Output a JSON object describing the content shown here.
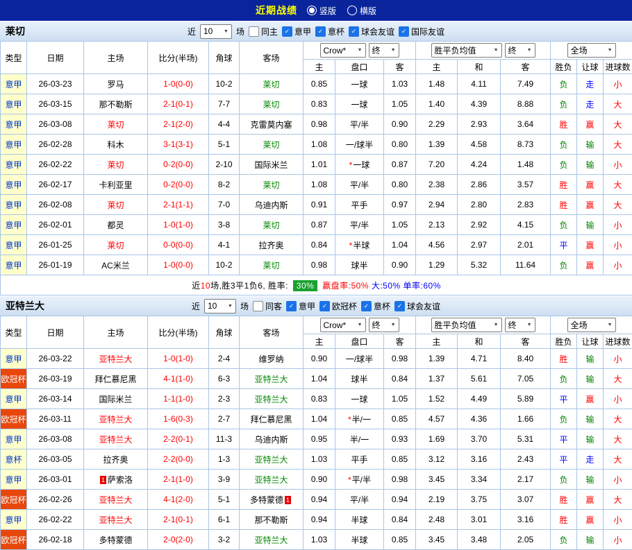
{
  "colors": {
    "topbar_bg": "#0a259c",
    "topbar_title": "#ffff00",
    "section_bar_bg": "#d2e2f4",
    "grid_border": "#a8c6e6",
    "league_serie_bg": "#ffffcc",
    "league_serie_text": "#0033cc",
    "league_ucl_bg": "#e8470b",
    "score_text": "#ff0000",
    "focal_home": "#ff0000",
    "focal_away": "#008800",
    "win_red": "#ff0000",
    "lose_green": "#008000",
    "draw_blue": "#0000ff",
    "checkbox_checked": "#1b73e8",
    "summary_badge_bg": "#18a12e"
  },
  "top_bar": {
    "title": "近期战绩",
    "layout_options": [
      {
        "label": "竖版",
        "selected": true
      },
      {
        "label": "横版",
        "selected": false
      }
    ]
  },
  "sections": [
    {
      "team": "莱切",
      "filter": {
        "near_label": "近",
        "count_value": "10",
        "unit_label": "场",
        "checkboxes": [
          {
            "label": "同主",
            "checked": false
          },
          {
            "label": "意甲",
            "checked": true
          },
          {
            "label": "意杯",
            "checked": true
          },
          {
            "label": "球会友谊",
            "checked": true
          },
          {
            "label": "国际友谊",
            "checked": true
          }
        ]
      },
      "header": {
        "cols": [
          "类型",
          "日期",
          "主场",
          "比分(半场)",
          "角球",
          "客场"
        ],
        "odds_company_select": "Crow*",
        "odds_time_select": "终",
        "europe_select": "胜平负均值",
        "europe_time_select": "终",
        "scope_select": "全场",
        "sub_cols": [
          "主",
          "盘口",
          "客",
          "主",
          "和",
          "客",
          "胜负",
          "让球",
          "进球数"
        ]
      },
      "rows": [
        {
          "league": "意甲",
          "lcls": "serie",
          "date": "26-03-23",
          "home": "罗马",
          "hcls": "",
          "hcard": "",
          "score": "1-0(0-0)",
          "corner": "10-2",
          "away": "莱切",
          "acls": "focal-away",
          "acard": "",
          "oh": "0.85",
          "line": "一球",
          "star": false,
          "oa": "1.03",
          "eu": [
            "1.48",
            "4.11",
            "7.49"
          ],
          "res": [
            {
              "t": "负",
              "c": "g"
            },
            {
              "t": "走",
              "c": "b"
            },
            {
              "t": "小",
              "c": "r"
            }
          ]
        },
        {
          "league": "意甲",
          "lcls": "serie",
          "date": "26-03-15",
          "home": "那不勒斯",
          "hcls": "",
          "hcard": "",
          "score": "2-1(0-1)",
          "corner": "7-7",
          "away": "莱切",
          "acls": "focal-away",
          "acard": "",
          "oh": "0.83",
          "line": "一球",
          "star": false,
          "oa": "1.05",
          "eu": [
            "1.40",
            "4.39",
            "8.88"
          ],
          "res": [
            {
              "t": "负",
              "c": "g"
            },
            {
              "t": "走",
              "c": "b"
            },
            {
              "t": "大",
              "c": "r"
            }
          ]
        },
        {
          "league": "意甲",
          "lcls": "serie",
          "date": "26-03-08",
          "home": "莱切",
          "hcls": "focal-home",
          "hcard": "",
          "score": "2-1(2-0)",
          "corner": "4-4",
          "away": "克雷莫内塞",
          "acls": "",
          "acard": "",
          "oh": "0.98",
          "line": "平/半",
          "star": false,
          "oa": "0.90",
          "eu": [
            "2.29",
            "2.93",
            "3.64"
          ],
          "res": [
            {
              "t": "胜",
              "c": "r"
            },
            {
              "t": "赢",
              "c": "r"
            },
            {
              "t": "大",
              "c": "r"
            }
          ]
        },
        {
          "league": "意甲",
          "lcls": "serie",
          "date": "26-02-28",
          "home": "科木",
          "hcls": "",
          "hcard": "",
          "score": "3-1(3-1)",
          "corner": "5-1",
          "away": "莱切",
          "acls": "focal-away",
          "acard": "",
          "oh": "1.08",
          "line": "一/球半",
          "star": false,
          "oa": "0.80",
          "eu": [
            "1.39",
            "4.58",
            "8.73"
          ],
          "res": [
            {
              "t": "负",
              "c": "g"
            },
            {
              "t": "输",
              "c": "g"
            },
            {
              "t": "大",
              "c": "r"
            }
          ]
        },
        {
          "league": "意甲",
          "lcls": "serie",
          "date": "26-02-22",
          "home": "莱切",
          "hcls": "focal-home",
          "hcard": "",
          "score": "0-2(0-0)",
          "corner": "2-10",
          "away": "国际米兰",
          "acls": "",
          "acard": "",
          "oh": "1.01",
          "line": "一球",
          "star": true,
          "oa": "0.87",
          "eu": [
            "7.20",
            "4.24",
            "1.48"
          ],
          "res": [
            {
              "t": "负",
              "c": "g"
            },
            {
              "t": "输",
              "c": "g"
            },
            {
              "t": "小",
              "c": "r"
            }
          ]
        },
        {
          "league": "意甲",
          "lcls": "serie",
          "date": "26-02-17",
          "home": "卡利亚里",
          "hcls": "",
          "hcard": "",
          "score": "0-2(0-0)",
          "corner": "8-2",
          "away": "莱切",
          "acls": "focal-away",
          "acard": "",
          "oh": "1.08",
          "line": "平/半",
          "star": false,
          "oa": "0.80",
          "eu": [
            "2.38",
            "2.86",
            "3.57"
          ],
          "res": [
            {
              "t": "胜",
              "c": "r"
            },
            {
              "t": "赢",
              "c": "r"
            },
            {
              "t": "大",
              "c": "r"
            }
          ]
        },
        {
          "league": "意甲",
          "lcls": "serie",
          "date": "26-02-08",
          "home": "莱切",
          "hcls": "focal-home",
          "hcard": "",
          "score": "2-1(1-1)",
          "corner": "7-0",
          "away": "乌迪内斯",
          "acls": "",
          "acard": "",
          "oh": "0.91",
          "line": "平手",
          "star": false,
          "oa": "0.97",
          "eu": [
            "2.94",
            "2.80",
            "2.83"
          ],
          "res": [
            {
              "t": "胜",
              "c": "r"
            },
            {
              "t": "赢",
              "c": "r"
            },
            {
              "t": "大",
              "c": "r"
            }
          ]
        },
        {
          "league": "意甲",
          "lcls": "serie",
          "date": "26-02-01",
          "home": "都灵",
          "hcls": "",
          "hcard": "",
          "score": "1-0(1-0)",
          "corner": "3-8",
          "away": "莱切",
          "acls": "focal-away",
          "acard": "",
          "oh": "0.87",
          "line": "平/半",
          "star": false,
          "oa": "1.05",
          "eu": [
            "2.13",
            "2.92",
            "4.15"
          ],
          "res": [
            {
              "t": "负",
              "c": "g"
            },
            {
              "t": "输",
              "c": "g"
            },
            {
              "t": "小",
              "c": "r"
            }
          ]
        },
        {
          "league": "意甲",
          "lcls": "serie",
          "date": "26-01-25",
          "home": "莱切",
          "hcls": "focal-home",
          "hcard": "",
          "score": "0-0(0-0)",
          "corner": "4-1",
          "away": "拉齐奥",
          "acls": "",
          "acard": "",
          "oh": "0.84",
          "line": "半球",
          "star": true,
          "oa": "1.04",
          "eu": [
            "4.56",
            "2.97",
            "2.01"
          ],
          "res": [
            {
              "t": "平",
              "c": "b"
            },
            {
              "t": "赢",
              "c": "r"
            },
            {
              "t": "小",
              "c": "r"
            }
          ]
        },
        {
          "league": "意甲",
          "lcls": "serie",
          "date": "26-01-19",
          "home": "AC米兰",
          "hcls": "",
          "hcard": "",
          "score": "1-0(0-0)",
          "corner": "10-2",
          "away": "莱切",
          "acls": "focal-away",
          "acard": "",
          "oh": "0.98",
          "line": "球半",
          "star": false,
          "oa": "0.90",
          "eu": [
            "1.29",
            "5.32",
            "11.64"
          ],
          "res": [
            {
              "t": "负",
              "c": "g"
            },
            {
              "t": "赢",
              "c": "r"
            },
            {
              "t": "小",
              "c": "r"
            }
          ]
        }
      ],
      "summary": {
        "text_before_count": "近",
        "count": "10",
        "text_after_count": "场,胜3平1负6, 胜率: ",
        "win_rate_badge": "30%",
        "handicap_rate": "赢盘率:50%",
        "big_rate": "大:50%",
        "single_rate": "单率:60%"
      }
    },
    {
      "team": "亚特兰大",
      "filter": {
        "near_label": "近",
        "count_value": "10",
        "unit_label": "场",
        "checkboxes": [
          {
            "label": "同客",
            "checked": false
          },
          {
            "label": "意甲",
            "checked": true
          },
          {
            "label": "欧冠杯",
            "checked": true
          },
          {
            "label": "意杯",
            "checked": true
          },
          {
            "label": "球会友谊",
            "checked": true
          }
        ]
      },
      "header": {
        "cols": [
          "类型",
          "日期",
          "主场",
          "比分(半场)",
          "角球",
          "客场"
        ],
        "odds_company_select": "Crow*",
        "odds_time_select": "终",
        "europe_select": "胜平负均值",
        "europe_time_select": "终",
        "scope_select": "全场",
        "sub_cols": [
          "主",
          "盘口",
          "客",
          "主",
          "和",
          "客",
          "胜负",
          "让球",
          "进球数"
        ]
      },
      "rows": [
        {
          "league": "意甲",
          "lcls": "serie",
          "date": "26-03-22",
          "home": "亚特兰大",
          "hcls": "focal-home",
          "hcard": "",
          "score": "1-0(1-0)",
          "corner": "2-4",
          "away": "维罗纳",
          "acls": "",
          "acard": "",
          "oh": "0.90",
          "line": "一/球半",
          "star": false,
          "oa": "0.98",
          "eu": [
            "1.39",
            "4.71",
            "8.40"
          ],
          "res": [
            {
              "t": "胜",
              "c": "r"
            },
            {
              "t": "输",
              "c": "g"
            },
            {
              "t": "小",
              "c": "r"
            }
          ]
        },
        {
          "league": "欧冠杯",
          "lcls": "ucl",
          "date": "26-03-19",
          "home": "拜仁慕尼黑",
          "hcls": "",
          "hcard": "",
          "score": "4-1(1-0)",
          "corner": "6-3",
          "away": "亚特兰大",
          "acls": "focal-away",
          "acard": "",
          "oh": "1.04",
          "line": "球半",
          "star": false,
          "oa": "0.84",
          "eu": [
            "1.37",
            "5.61",
            "7.05"
          ],
          "res": [
            {
              "t": "负",
              "c": "g"
            },
            {
              "t": "输",
              "c": "g"
            },
            {
              "t": "大",
              "c": "r"
            }
          ]
        },
        {
          "league": "意甲",
          "lcls": "serie",
          "date": "26-03-14",
          "home": "国际米兰",
          "hcls": "",
          "hcard": "",
          "score": "1-1(1-0)",
          "corner": "2-3",
          "away": "亚特兰大",
          "acls": "focal-away",
          "acard": "",
          "oh": "0.83",
          "line": "一球",
          "star": false,
          "oa": "1.05",
          "eu": [
            "1.52",
            "4.49",
            "5.89"
          ],
          "res": [
            {
              "t": "平",
              "c": "b"
            },
            {
              "t": "赢",
              "c": "r"
            },
            {
              "t": "小",
              "c": "r"
            }
          ]
        },
        {
          "league": "欧冠杯",
          "lcls": "ucl",
          "date": "26-03-11",
          "home": "亚特兰大",
          "hcls": "focal-home",
          "hcard": "",
          "score": "1-6(0-3)",
          "corner": "2-7",
          "away": "拜仁慕尼黑",
          "acls": "",
          "acard": "",
          "oh": "1.04",
          "line": "半/一",
          "star": true,
          "oa": "0.85",
          "eu": [
            "4.57",
            "4.36",
            "1.66"
          ],
          "res": [
            {
              "t": "负",
              "c": "g"
            },
            {
              "t": "输",
              "c": "g"
            },
            {
              "t": "大",
              "c": "r"
            }
          ]
        },
        {
          "league": "意甲",
          "lcls": "serie",
          "date": "26-03-08",
          "home": "亚特兰大",
          "hcls": "focal-home",
          "hcard": "",
          "score": "2-2(0-1)",
          "corner": "11-3",
          "away": "乌迪内斯",
          "acls": "",
          "acard": "",
          "oh": "0.95",
          "line": "半/一",
          "star": false,
          "oa": "0.93",
          "eu": [
            "1.69",
            "3.70",
            "5.31"
          ],
          "res": [
            {
              "t": "平",
              "c": "b"
            },
            {
              "t": "输",
              "c": "g"
            },
            {
              "t": "大",
              "c": "r"
            }
          ]
        },
        {
          "league": "意杯",
          "lcls": "serie",
          "date": "26-03-05",
          "home": "拉齐奥",
          "hcls": "",
          "hcard": "",
          "score": "2-2(0-0)",
          "corner": "1-3",
          "away": "亚特兰大",
          "acls": "focal-away",
          "acard": "",
          "oh": "1.03",
          "line": "平手",
          "star": false,
          "oa": "0.85",
          "eu": [
            "3.12",
            "3.16",
            "2.43"
          ],
          "res": [
            {
              "t": "平",
              "c": "b"
            },
            {
              "t": "走",
              "c": "b"
            },
            {
              "t": "大",
              "c": "r"
            }
          ]
        },
        {
          "league": "意甲",
          "lcls": "serie",
          "date": "26-03-01",
          "home": "萨索洛",
          "hcls": "",
          "hcard": "1",
          "score": "2-1(1-0)",
          "corner": "3-9",
          "away": "亚特兰大",
          "acls": "focal-away",
          "acard": "",
          "oh": "0.90",
          "line": "平/半",
          "star": true,
          "oa": "0.98",
          "eu": [
            "3.45",
            "3.34",
            "2.17"
          ],
          "res": [
            {
              "t": "负",
              "c": "g"
            },
            {
              "t": "输",
              "c": "g"
            },
            {
              "t": "小",
              "c": "r"
            }
          ]
        },
        {
          "league": "欧冠杯",
          "lcls": "ucl",
          "date": "26-02-26",
          "home": "亚特兰大",
          "hcls": "focal-home",
          "hcard": "",
          "score": "4-1(2-0)",
          "corner": "5-1",
          "away": "多特蒙德",
          "acls": "",
          "acard": "1",
          "oh": "0.94",
          "line": "平/半",
          "star": false,
          "oa": "0.94",
          "eu": [
            "2.19",
            "3.75",
            "3.07"
          ],
          "res": [
            {
              "t": "胜",
              "c": "r"
            },
            {
              "t": "赢",
              "c": "r"
            },
            {
              "t": "大",
              "c": "r"
            }
          ]
        },
        {
          "league": "意甲",
          "lcls": "serie",
          "date": "26-02-22",
          "home": "亚特兰大",
          "hcls": "focal-home",
          "hcard": "",
          "score": "2-1(0-1)",
          "corner": "6-1",
          "away": "那不勒斯",
          "acls": "",
          "acard": "",
          "oh": "0.94",
          "line": "半球",
          "star": false,
          "oa": "0.84",
          "eu": [
            "2.48",
            "3.01",
            "3.16"
          ],
          "res": [
            {
              "t": "胜",
              "c": "r"
            },
            {
              "t": "赢",
              "c": "r"
            },
            {
              "t": "小",
              "c": "r"
            }
          ]
        },
        {
          "league": "欧冠杯",
          "lcls": "ucl",
          "date": "26-02-18",
          "home": "多特蒙德",
          "hcls": "",
          "hcard": "",
          "score": "2-0(2-0)",
          "corner": "3-2",
          "away": "亚特兰大",
          "acls": "focal-away",
          "acard": "",
          "oh": "1.03",
          "line": "半球",
          "star": false,
          "oa": "0.85",
          "eu": [
            "3.45",
            "3.48",
            "2.05"
          ],
          "res": [
            {
              "t": "负",
              "c": "g"
            },
            {
              "t": "输",
              "c": "g"
            },
            {
              "t": "小",
              "c": "r"
            }
          ]
        }
      ]
    }
  ]
}
